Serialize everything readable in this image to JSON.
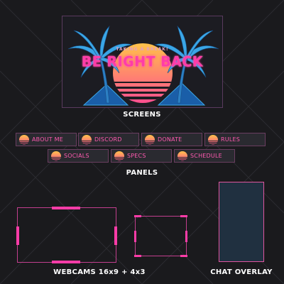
{
  "screen": {
    "subtitle": "TAKING A BREAK!",
    "title": "BE RIGHT BACK",
    "caption": "SCREENS"
  },
  "panels": {
    "caption": "PANELS",
    "items": [
      {
        "label": "ABOUT ME"
      },
      {
        "label": "DISCORD"
      },
      {
        "label": "DONATE"
      },
      {
        "label": "RULES"
      },
      {
        "label": "SOCIALS"
      },
      {
        "label": "SPECS"
      },
      {
        "label": "SCHEDULE"
      }
    ]
  },
  "webcams": {
    "caption": "WEBCAMS 16x9 + 4x3"
  },
  "chat": {
    "caption": "CHAT OVERLAY"
  },
  "colors": {
    "accent_pink": "#ff3ca8",
    "palm_blue": "#3aa6e6",
    "sun_top": "#ffc24a",
    "sun_bottom": "#ff4f8f",
    "background": "#1a1a1d"
  }
}
